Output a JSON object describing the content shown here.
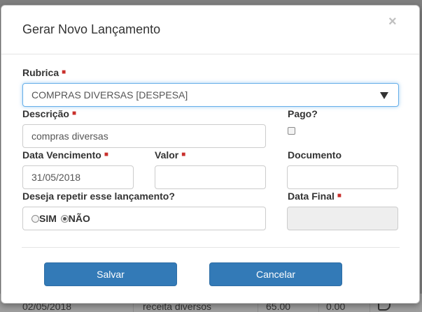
{
  "modal": {
    "title": "Gerar Novo Lançamento",
    "close_label": "×"
  },
  "form": {
    "rubrica": {
      "label": "Rubrica",
      "value": "COMPRAS DIVERSAS [DESPESA]"
    },
    "descricao": {
      "label": "Descrição",
      "value": "compras diversas"
    },
    "pago": {
      "label": "Pago?",
      "checked": false
    },
    "data_vencimento": {
      "label": "Data Vencimento",
      "value": "31/05/2018"
    },
    "valor": {
      "label": "Valor",
      "value": ""
    },
    "documento": {
      "label": "Documento",
      "value": ""
    },
    "repetir": {
      "label": "Deseja repetir esse lançamento?",
      "options": [
        {
          "label": "SIM",
          "checked": false
        },
        {
          "label": "NÃO",
          "checked": true
        }
      ]
    },
    "data_final": {
      "label": "Data Final",
      "value": "",
      "disabled": true
    }
  },
  "footer": {
    "save_label": "Salvar",
    "cancel_label": "Cancelar"
  },
  "background_row": {
    "date": "02/05/2018",
    "description": "receita diversos",
    "value": "65.00",
    "paid": "0.00"
  },
  "colors": {
    "primary": "#337ab7",
    "required_marker": "#c9302c",
    "overlay": "#7f7f7f"
  }
}
